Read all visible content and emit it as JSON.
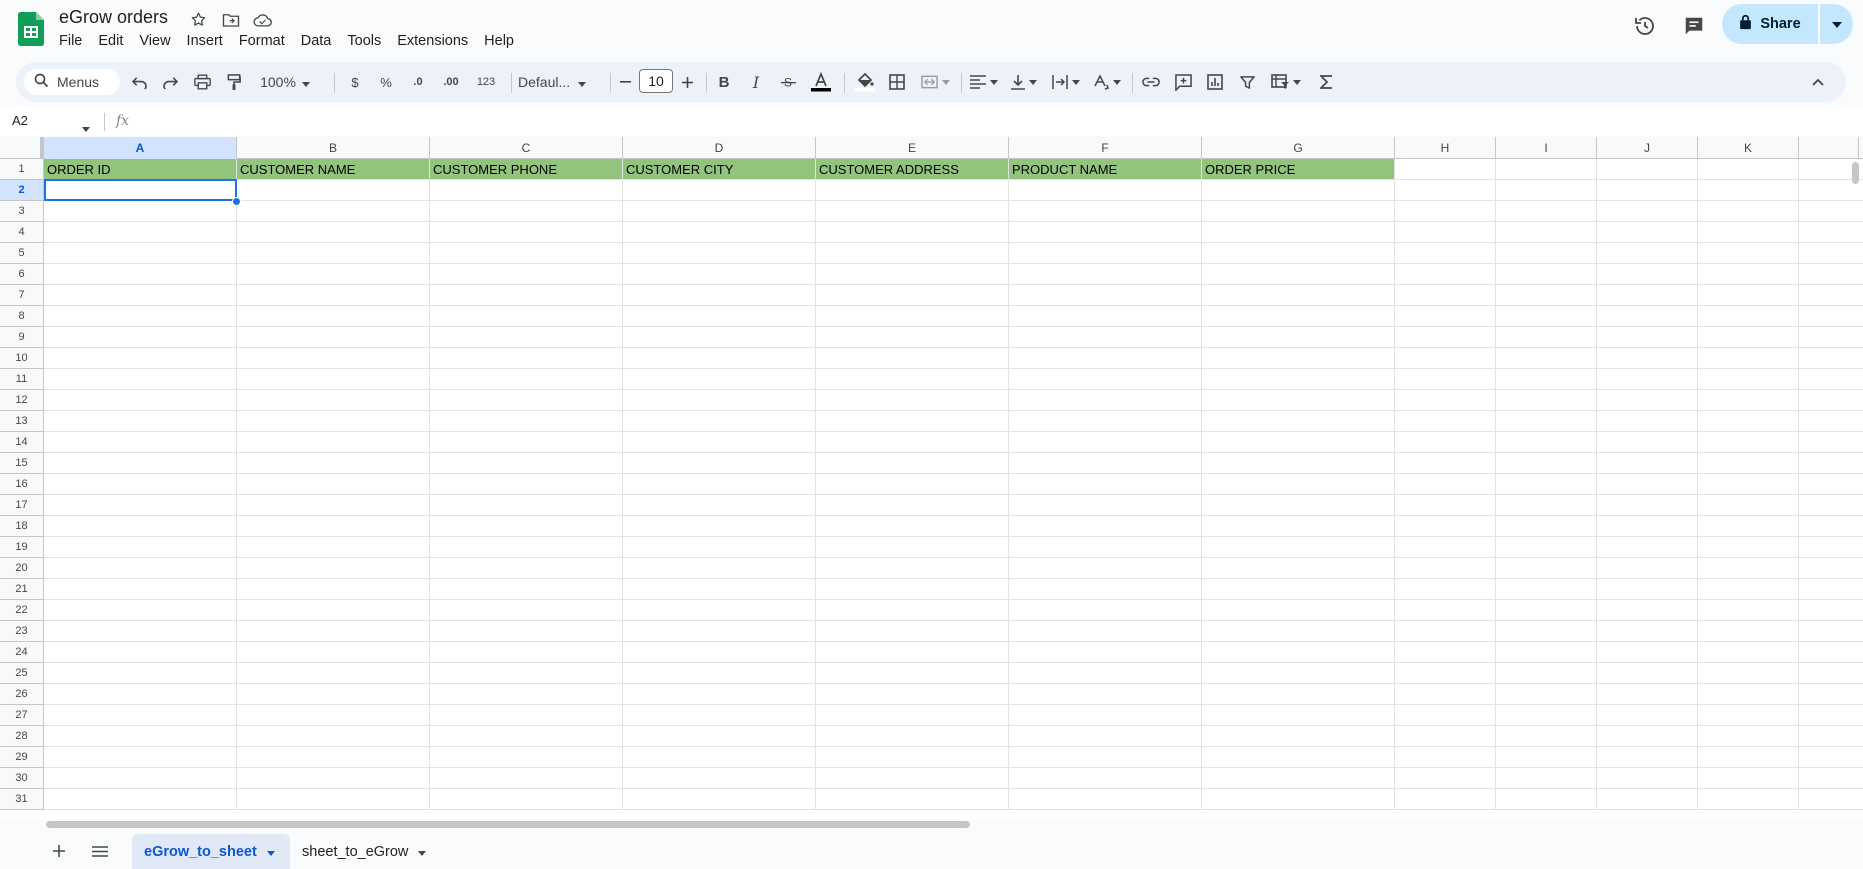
{
  "app": {
    "doc_title": "eGrow orders",
    "accent_color": "#0b57d0",
    "header_fill_color": "#93c47d"
  },
  "menubar": {
    "items": [
      "File",
      "Edit",
      "View",
      "Insert",
      "Format",
      "Data",
      "Tools",
      "Extensions",
      "Help"
    ]
  },
  "top_right": {
    "share_label": "Share",
    "icons": [
      "version-history-icon",
      "comments-icon",
      "lock-icon",
      "chevron-down-icon"
    ]
  },
  "toolbar": {
    "search_label": "Menus",
    "zoom": "100%",
    "currency_label": "$",
    "percent_label": "%",
    "decrease_decimal_label": ".0",
    "increase_decimal_label": ".00",
    "number_format_label": "123",
    "font_name": "Defaul...",
    "font_size": "10"
  },
  "formula_bar": {
    "cell_ref": "A2",
    "fx_label": "fx",
    "value": ""
  },
  "grid": {
    "columns": [
      "A",
      "B",
      "C",
      "D",
      "E",
      "F",
      "G",
      "H",
      "I",
      "J",
      "K"
    ],
    "rows": [
      "1",
      "2",
      "3",
      "4",
      "5",
      "6",
      "7",
      "8",
      "9",
      "10",
      "11",
      "12",
      "13",
      "14",
      "15",
      "16",
      "17",
      "18",
      "19",
      "20",
      "21",
      "22",
      "23",
      "24",
      "25",
      "26",
      "27",
      "28",
      "29",
      "30",
      "31"
    ],
    "header_row": [
      "ORDER ID",
      "CUSTOMER NAME",
      "CUSTOMER PHONE",
      "CUSTOMER CITY",
      "CUSTOMER ADDRESS",
      "PRODUCT NAME",
      "ORDER PRICE"
    ],
    "selected_cell": "A2",
    "active_column": "A",
    "active_row": "2"
  },
  "sheets": {
    "tabs": [
      {
        "label": "eGrow_to_sheet",
        "active": true
      },
      {
        "label": "sheet_to_eGrow",
        "active": false
      }
    ]
  }
}
